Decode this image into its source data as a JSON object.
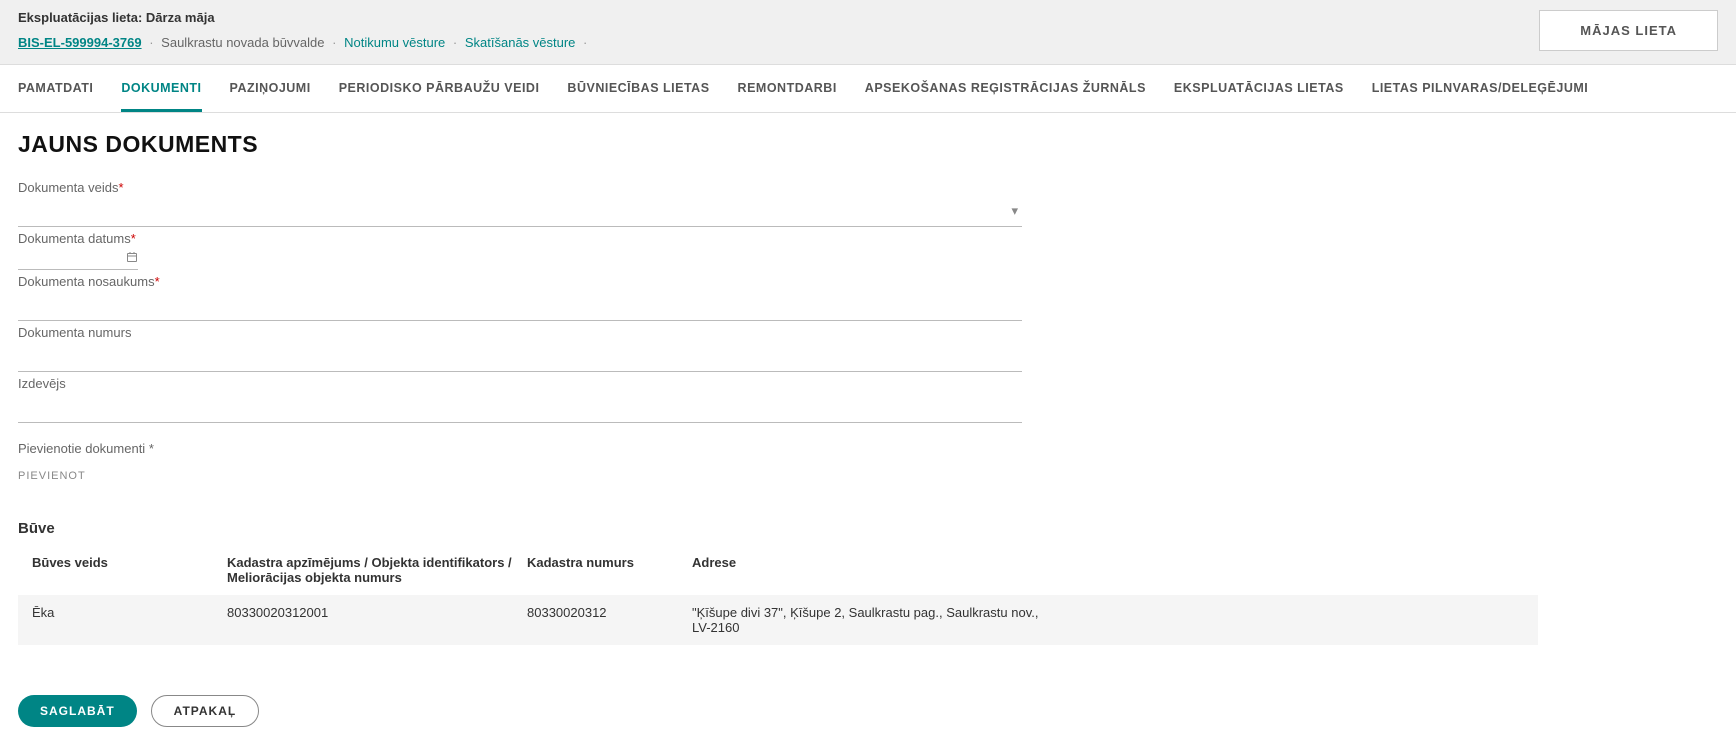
{
  "header": {
    "title": "Ekspluatācijas lieta: Dārza māja",
    "case_link": "BIS-EL-599994-3769",
    "org": "Saulkrastu novada būvvalde",
    "history_link": "Notikumu vēsture",
    "view_history_link": "Skatīšanās vēsture",
    "side_button": "Mājas lieta"
  },
  "tabs": [
    "Pamatdati",
    "Dokumenti",
    "Paziņojumi",
    "Periodisko pārbaužu veidi",
    "Būvniecības lietas",
    "Remontdarbi",
    "Apsekošanas reģistrācijas žurnāls",
    "Ekspluatācijas lietas",
    "Lietas pilnvaras/deleģējumi"
  ],
  "page_title": "JAUNS DOKUMENTS",
  "form": {
    "doc_type_label": "Dokumenta veids",
    "doc_date_label": "Dokumenta datums",
    "doc_name_label": "Dokumenta nosaukums",
    "doc_number_label": "Dokumenta numurs",
    "issuer_label": "Izdevējs",
    "attachments_label": "Pievienotie dokumenti",
    "attach_button": "Pievienot"
  },
  "section_building": "Būve",
  "table": {
    "headers": {
      "type": "Būves veids",
      "cadastre_id": "Kadastra apzīmējums / Objekta identifikators / Meliorācijas objekta numurs",
      "cadastre_num": "Kadastra numurs",
      "address": "Adrese"
    },
    "rows": [
      {
        "type": "Ēka",
        "cadastre_id": "80330020312001",
        "cadastre_num": "80330020312",
        "address": "\"Ķīšupe divi 37\", Ķīšupe 2, Saulkrastu pag., Saulkrastu nov., LV-2160"
      }
    ]
  },
  "buttons": {
    "save": "Saglabāt",
    "back": "Atpakaļ"
  }
}
